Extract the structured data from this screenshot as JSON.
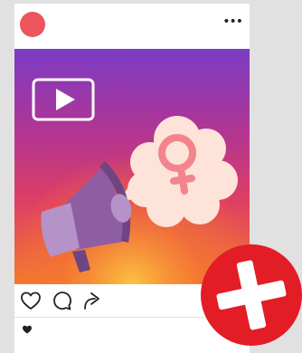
{
  "post": {
    "avatar_color": "#ec555c",
    "more_label": "•••",
    "media": {
      "gradient_colors": [
        "#7b3cc4",
        "#b13593",
        "#de3e63",
        "#f5782f",
        "#fbc241"
      ],
      "play_icon": "play-icon",
      "megaphone_icon": "megaphone-icon",
      "speech_icon": "speech-bubble-icon",
      "symbol_icon": "female-symbol-icon",
      "bubble_color": "#fde3d8",
      "symbol_color": "#f2848e",
      "megaphone_colors": [
        "#8e5ea3",
        "#b592c8"
      ]
    },
    "actions": {
      "like_icon": "heart-icon",
      "comment_icon": "comment-icon",
      "share_icon": "share-icon"
    },
    "likes_icon": "heart-filled-icon"
  },
  "close_button": {
    "icon": "close-icon",
    "background": "#e21d26",
    "symbol_color": "#ffffff"
  }
}
